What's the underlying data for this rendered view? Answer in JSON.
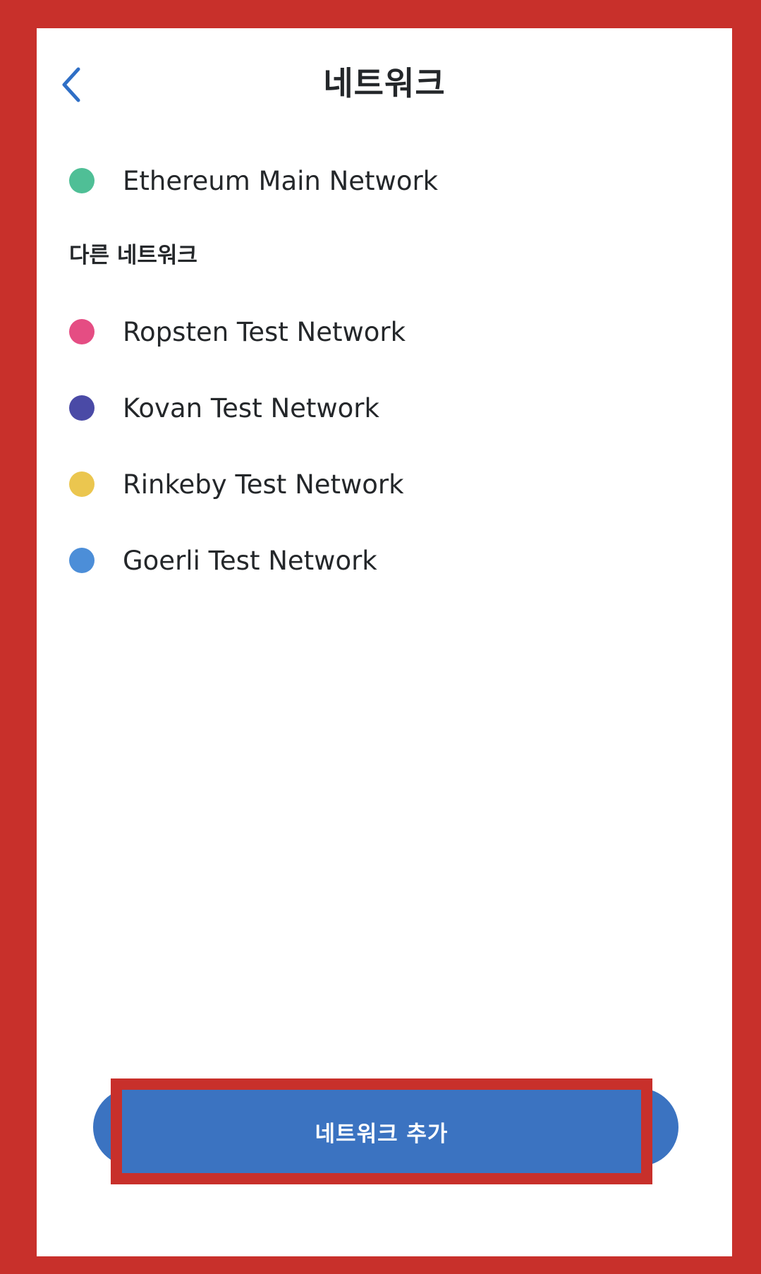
{
  "header": {
    "title": "네트워크",
    "back_icon": "chevron-left-icon",
    "accent_color": "#2f6fc6"
  },
  "networks": {
    "main": {
      "label": "Ethereum Main Network",
      "color": "#4fbf96"
    },
    "section_label": "다른 네트워크",
    "others": [
      {
        "label": "Ropsten Test Network",
        "color": "#e54d83"
      },
      {
        "label": "Kovan Test Network",
        "color": "#4a4aa6"
      },
      {
        "label": "Rinkeby Test Network",
        "color": "#ebc64f"
      },
      {
        "label": "Goerli Test Network",
        "color": "#4c8ed8"
      }
    ]
  },
  "actions": {
    "add_network_label": "네트워크 추가",
    "button_color": "#3b73c1",
    "highlight_color": "#c8302b"
  }
}
